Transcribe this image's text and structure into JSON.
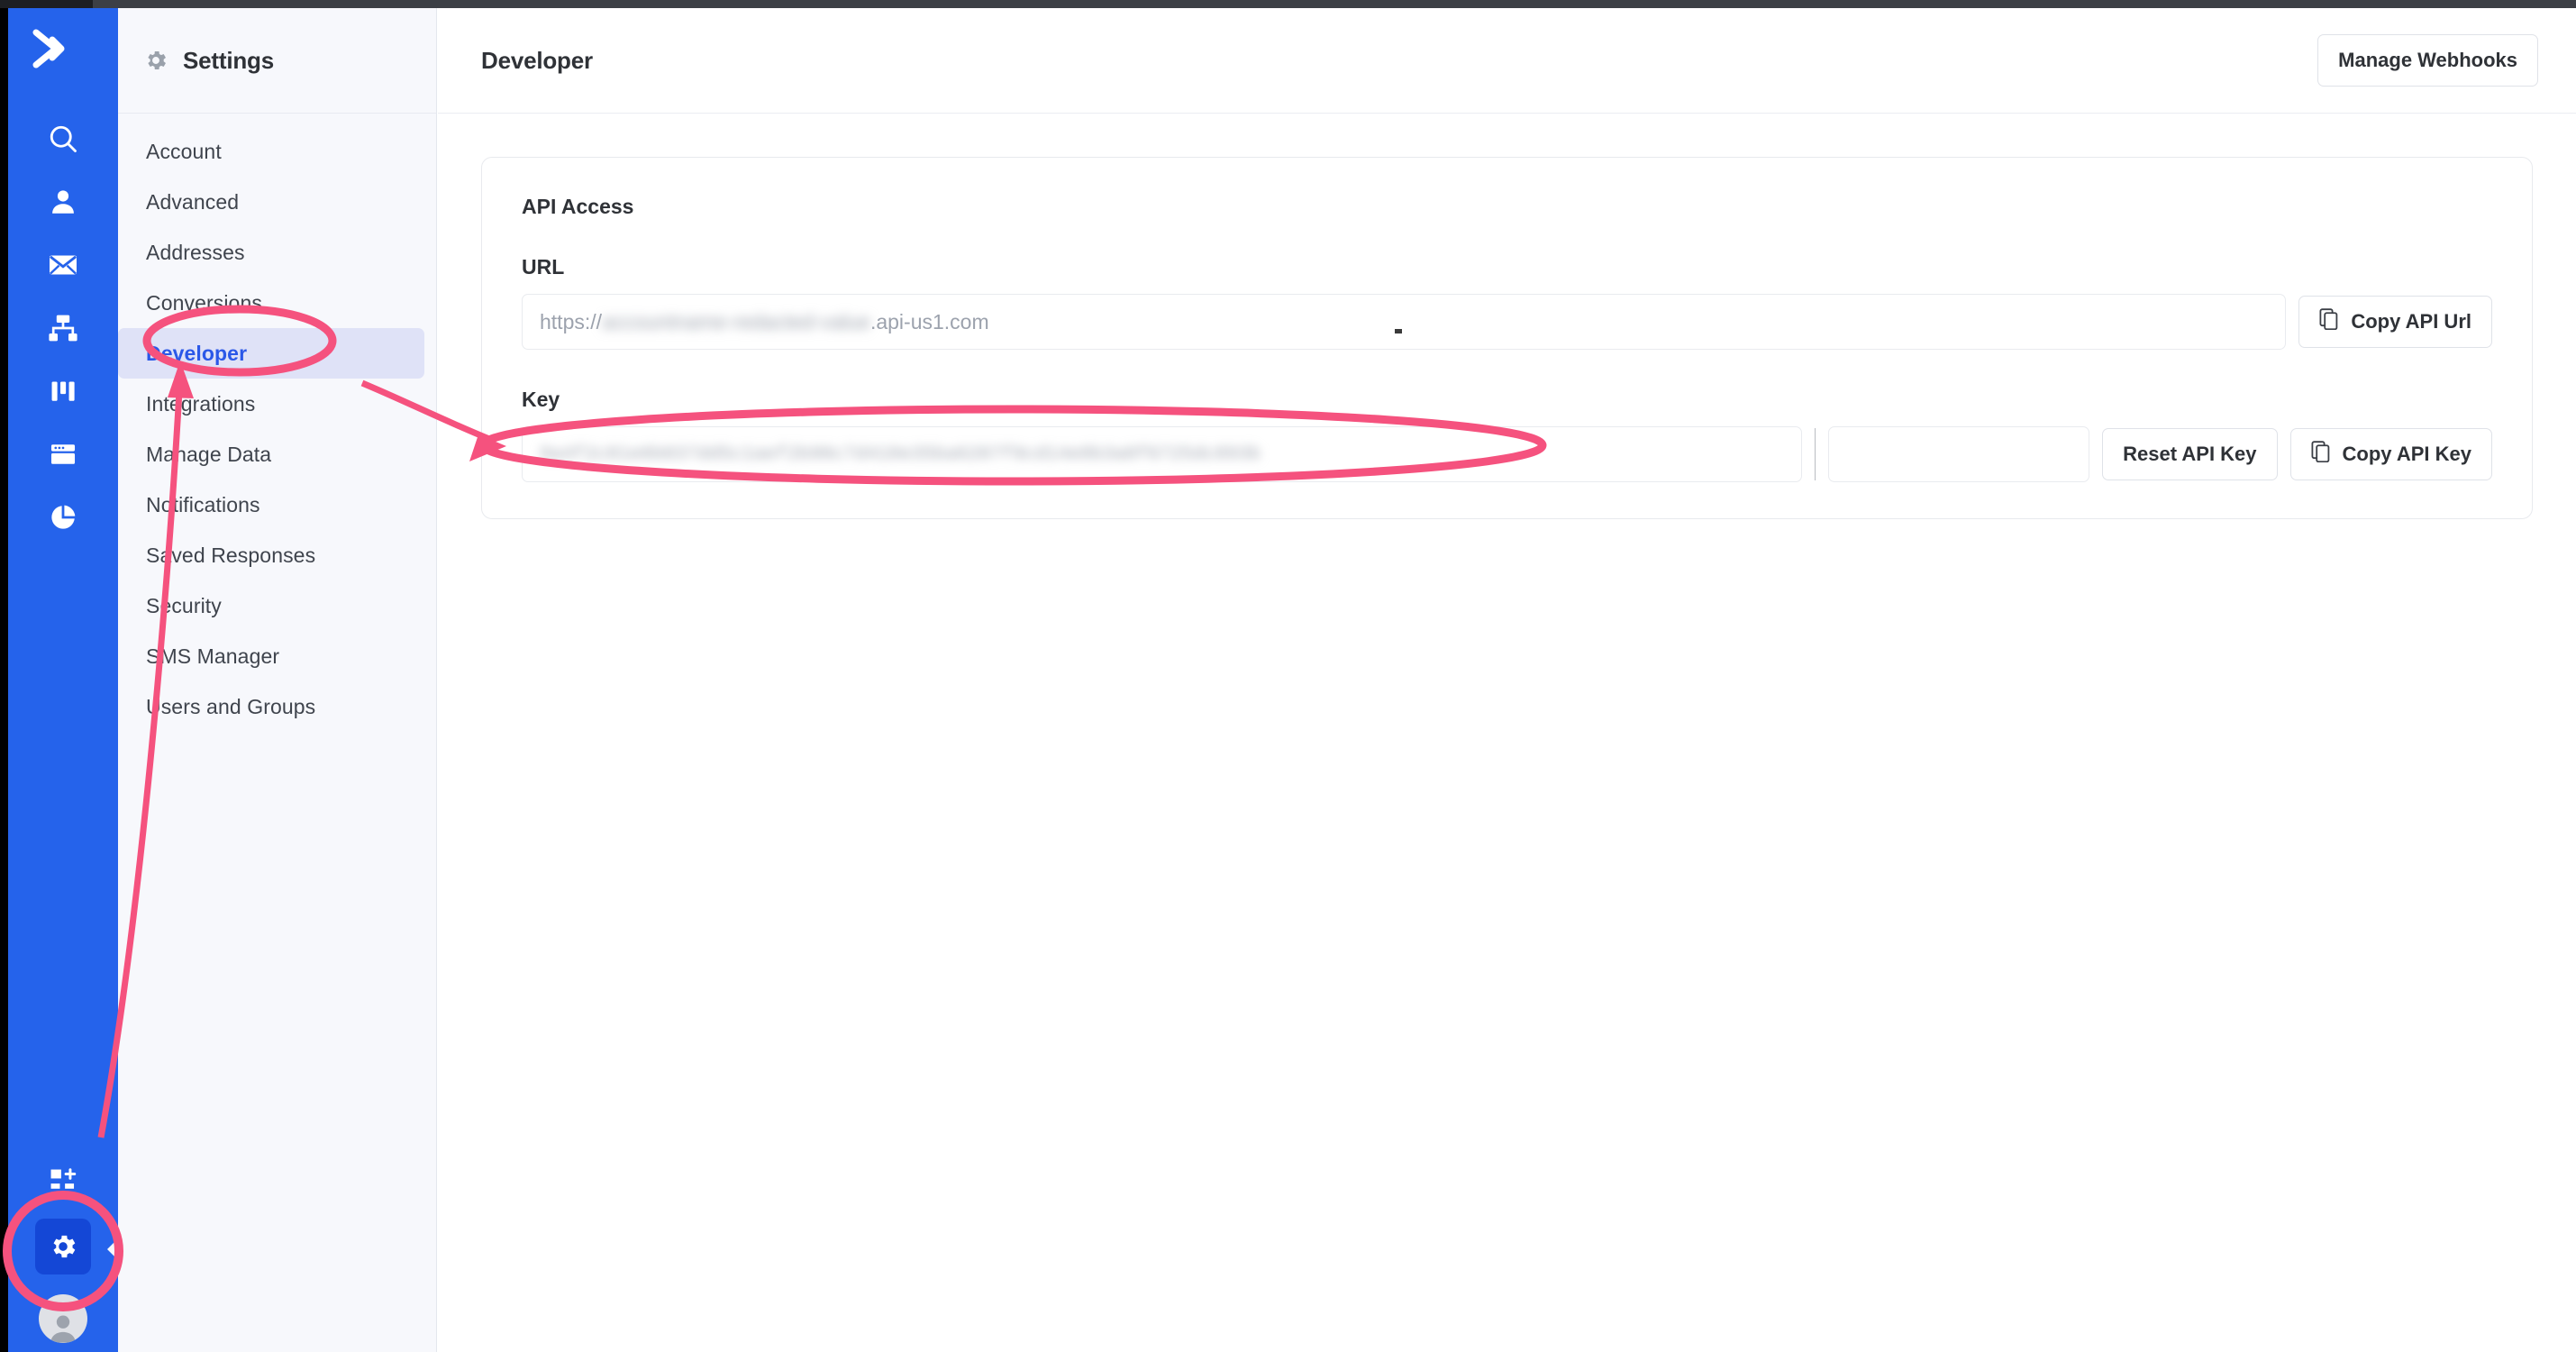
{
  "app": {
    "logo_icon": "double-chevron-logo",
    "accent_blue": "#2563eb",
    "annotation_color": "#f5527e",
    "active_nav_color": "#2b58e8"
  },
  "rail": {
    "icons": [
      {
        "name": "search-icon",
        "label": "Search"
      },
      {
        "name": "contacts-icon",
        "label": "Contacts"
      },
      {
        "name": "campaigns-email-icon",
        "label": "Campaigns"
      },
      {
        "name": "automations-icon",
        "label": "Automations"
      },
      {
        "name": "deals-kanban-icon",
        "label": "Deals"
      },
      {
        "name": "website-pages-icon",
        "label": "Website"
      },
      {
        "name": "reports-pie-icon",
        "label": "Reports"
      }
    ],
    "bottom": [
      {
        "name": "add-app-icon",
        "label": "Apps"
      },
      {
        "name": "settings-gear-icon",
        "label": "Settings"
      },
      {
        "name": "user-avatar",
        "label": "Account"
      }
    ]
  },
  "sidebar": {
    "title": "Settings",
    "title_icon": "gear-icon",
    "items": [
      {
        "label": "Account",
        "active": false
      },
      {
        "label": "Advanced",
        "active": false
      },
      {
        "label": "Addresses",
        "active": false
      },
      {
        "label": "Conversions",
        "active": false
      },
      {
        "label": "Developer",
        "active": true
      },
      {
        "label": "Integrations",
        "active": false
      },
      {
        "label": "Manage Data",
        "active": false
      },
      {
        "label": "Notifications",
        "active": false
      },
      {
        "label": "Saved Responses",
        "active": false
      },
      {
        "label": "Security",
        "active": false
      },
      {
        "label": "SMS Manager",
        "active": false
      },
      {
        "label": "Users and Groups",
        "active": false
      }
    ]
  },
  "header": {
    "title": "Developer",
    "manage_webhooks_label": "Manage Webhooks"
  },
  "main": {
    "card_title": "API Access",
    "url": {
      "label": "URL",
      "value_prefix": "https://",
      "value_redacted": "accountname-redacted-value",
      "value_suffix": ".api-us1.com",
      "copy_button_label": "Copy API Url",
      "copy_button_icon": "copy-icon"
    },
    "key": {
      "label": "Key",
      "value_redacted": "9a4f2c81e6b037dd5c1aef2b90c7d418e35ba6207f9cd14e8b3a0f6725dc893b",
      "reset_button_label": "Reset API Key",
      "copy_button_label": "Copy API Key",
      "copy_button_icon": "copy-icon"
    }
  },
  "annotations": {
    "ellipse_developer": "highlight-ellipse-around-developer-nav-item",
    "ellipse_api_key": "highlight-ellipse-around-api-key-field",
    "circle_settings_gear": "highlight-circle-around-settings-gear",
    "arrow_to_integrations": "arrow-from-settings-gear-to-developer-nav",
    "arrow_to_key": "arrow-from-developer-nav-to-api-key-field"
  }
}
